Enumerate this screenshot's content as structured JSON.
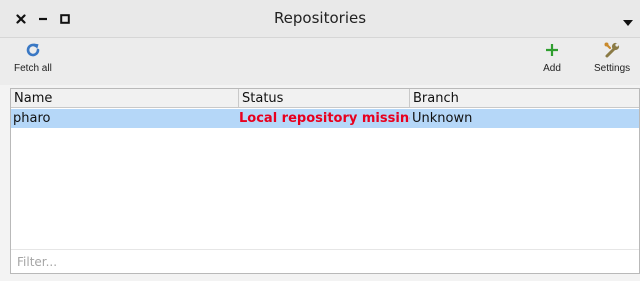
{
  "window": {
    "title": "Repositories"
  },
  "colors": {
    "status_missing": "#e8001e",
    "accent_blue": "#3a78c4",
    "accent_green": "#2f9e2f",
    "selection": "#b5d7f8"
  },
  "toolbar": {
    "fetch_all": {
      "label": "Fetch all",
      "icon": "refresh-icon"
    },
    "add": {
      "label": "Add",
      "icon": "plus-icon"
    },
    "settings": {
      "label": "Settings",
      "icon": "wrench-icon"
    }
  },
  "table": {
    "columns": [
      "Name",
      "Status",
      "Branch"
    ],
    "rows": [
      {
        "name": "pharo",
        "status": "Local repository missing",
        "branch": "Unknown"
      }
    ]
  },
  "filter": {
    "placeholder": "Filter..."
  }
}
